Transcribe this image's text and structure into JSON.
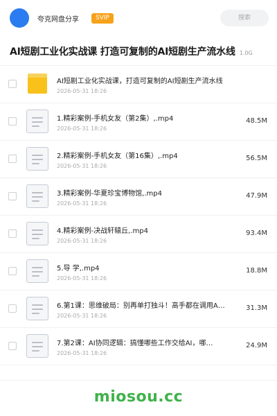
{
  "header": {
    "brand": "夸克网盘分享",
    "badge": "SVIP",
    "search_placeholder": "搜索",
    "avatar_color": "#2a7cf0",
    "badge_color": "#f7a21b"
  },
  "share": {
    "title": "AI短剧工业化实战课 打造可复制的AI短剧生产流水线",
    "total_size": "1.0G"
  },
  "files": [
    {
      "icon": "folder-icon",
      "name": "AI短剧工业化实战课，打造可复制的AI短剧生产流水线",
      "date": "2026-05-31 18:26",
      "size": ""
    },
    {
      "icon": "document-icon",
      "name": "1.精彩案例-手机女友（第2集）,.mp4",
      "date": "2026-05-31 18:26",
      "size": "48.5M"
    },
    {
      "icon": "document-icon",
      "name": "2.精彩案例-手机女友（第16集）,.mp4",
      "date": "2026-05-31 18:26",
      "size": "56.5M"
    },
    {
      "icon": "document-icon",
      "name": "3.精彩案例-华夏珍宝博物馆,.mp4",
      "date": "2026-05-31 18:26",
      "size": "47.9M"
    },
    {
      "icon": "document-icon",
      "name": "4.精彩案例-决战轩辕丘,.mp4",
      "date": "2026-05-31 18:26",
      "size": "93.4M"
    },
    {
      "icon": "document-icon",
      "name": "5.导 学,.mp4",
      "date": "2026-05-31 18:26",
      "size": "18.8M"
    },
    {
      "icon": "document-icon",
      "name": "6.第1课：思维破局：别再单打独斗！高手都在调用A…",
      "date": "2026-05-31 18:26",
      "size": "31.3M"
    },
    {
      "icon": "document-icon",
      "name": "7.第2课：AI协同逻辑：搞懂哪些工作交给AI，哪…",
      "date": "2026-05-31 18:26",
      "size": "24.9M"
    }
  ],
  "watermark": {
    "text": "miosou.cc",
    "color": "#3fb24a"
  }
}
